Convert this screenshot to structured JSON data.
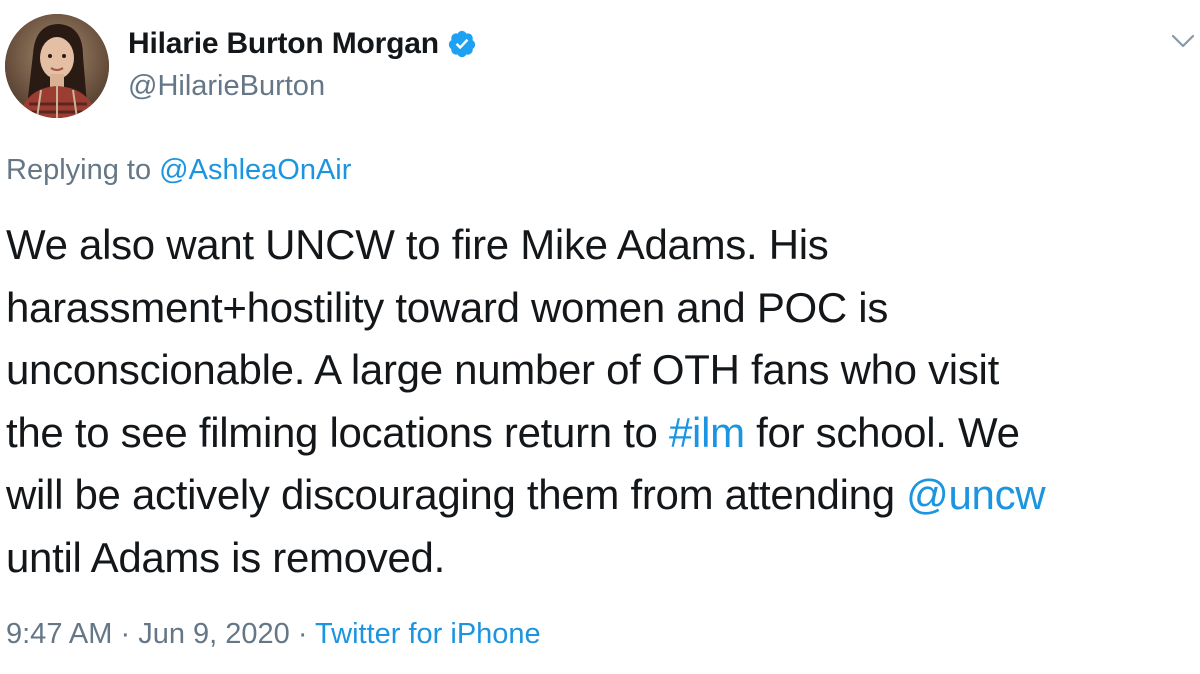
{
  "author": {
    "name": "Hilarie Burton Morgan",
    "handle": "@HilarieBurton",
    "verified_icon": "verified-badge-icon",
    "avatar": "avatar-photo"
  },
  "menu": {
    "icon": "chevron-down-icon"
  },
  "reply": {
    "prefix": "Replying to ",
    "mention": "@AshleaOnAir"
  },
  "tweet": {
    "lines": [
      [
        "We also want UNCW to fire Mike Adams. His"
      ],
      [
        "harassment+hostility toward women and POC is"
      ],
      [
        "unconscionable. A large number of OTH fans who visit"
      ],
      [
        "the to see filming locations return to ",
        "#ilm",
        " for school. We"
      ],
      [
        "will be actively discouraging them from attending ",
        "@uncw"
      ],
      [
        "until Adams is removed."
      ]
    ]
  },
  "meta": {
    "time": "9:47 AM",
    "separator1": " · ",
    "date": "Jun 9, 2020",
    "separator2": " · ",
    "source": "Twitter for iPhone"
  },
  "colors": {
    "link": "#1b95e0",
    "secondary": "#657786",
    "text": "#14171a",
    "verified": "#1da1f2"
  }
}
